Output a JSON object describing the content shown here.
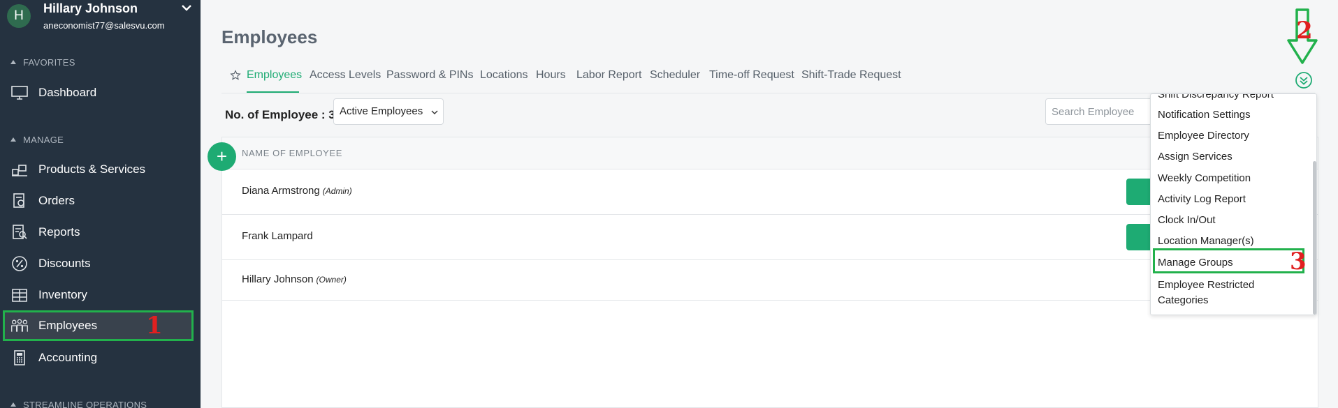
{
  "user": {
    "initial": "H",
    "name": "Hillary Johnson",
    "email": "aneconomist77@salesvu.com"
  },
  "sidebar": {
    "sections": {
      "favorites": "FAVORITES",
      "manage": "MANAGE",
      "streamline": "STREAMLINE OPERATIONS"
    },
    "items": [
      {
        "label": "Dashboard",
        "icon": "monitor-icon"
      },
      {
        "label": "Products & Services",
        "icon": "products-icon"
      },
      {
        "label": "Orders",
        "icon": "orders-icon"
      },
      {
        "label": "Reports",
        "icon": "reports-icon"
      },
      {
        "label": "Discounts",
        "icon": "percent-icon"
      },
      {
        "label": "Inventory",
        "icon": "inventory-icon"
      },
      {
        "label": "Employees",
        "icon": "employees-icon"
      },
      {
        "label": "Accounting",
        "icon": "calculator-icon"
      }
    ]
  },
  "page": {
    "title": "Employees"
  },
  "tabs": [
    "Employees",
    "Access Levels",
    "Password & PINs",
    "Locations",
    "Hours",
    "Labor Report",
    "Scheduler",
    "Time-off Request",
    "Shift-Trade Request"
  ],
  "toolbar": {
    "count_label": "No. of Employee : 3",
    "filter_value": "Active Employees",
    "search_placeholder": "Search Employee"
  },
  "table": {
    "header": "NAME OF EMPLOYEE",
    "rows": [
      {
        "name": "Diana Armstrong",
        "role": "(Admin)"
      },
      {
        "name": "Frank Lampard",
        "role": ""
      },
      {
        "name": "Hillary Johnson",
        "role": "(Owner)"
      }
    ]
  },
  "dropdown": {
    "items": [
      "Shift Discrepancy Report",
      "Notification Settings",
      "Employee Directory",
      "Assign Services",
      "Weekly Competition",
      "Activity Log Report",
      "Clock In/Out",
      "Location Manager(s)",
      "Manage Groups",
      "Employee Restricted Categories"
    ]
  },
  "annotations": {
    "one": "1",
    "two": "2",
    "three": "3"
  },
  "colors": {
    "sidebar": "#253240",
    "accent": "#1eab73",
    "highlight": "#22b14c",
    "annotation": "#e02020"
  }
}
